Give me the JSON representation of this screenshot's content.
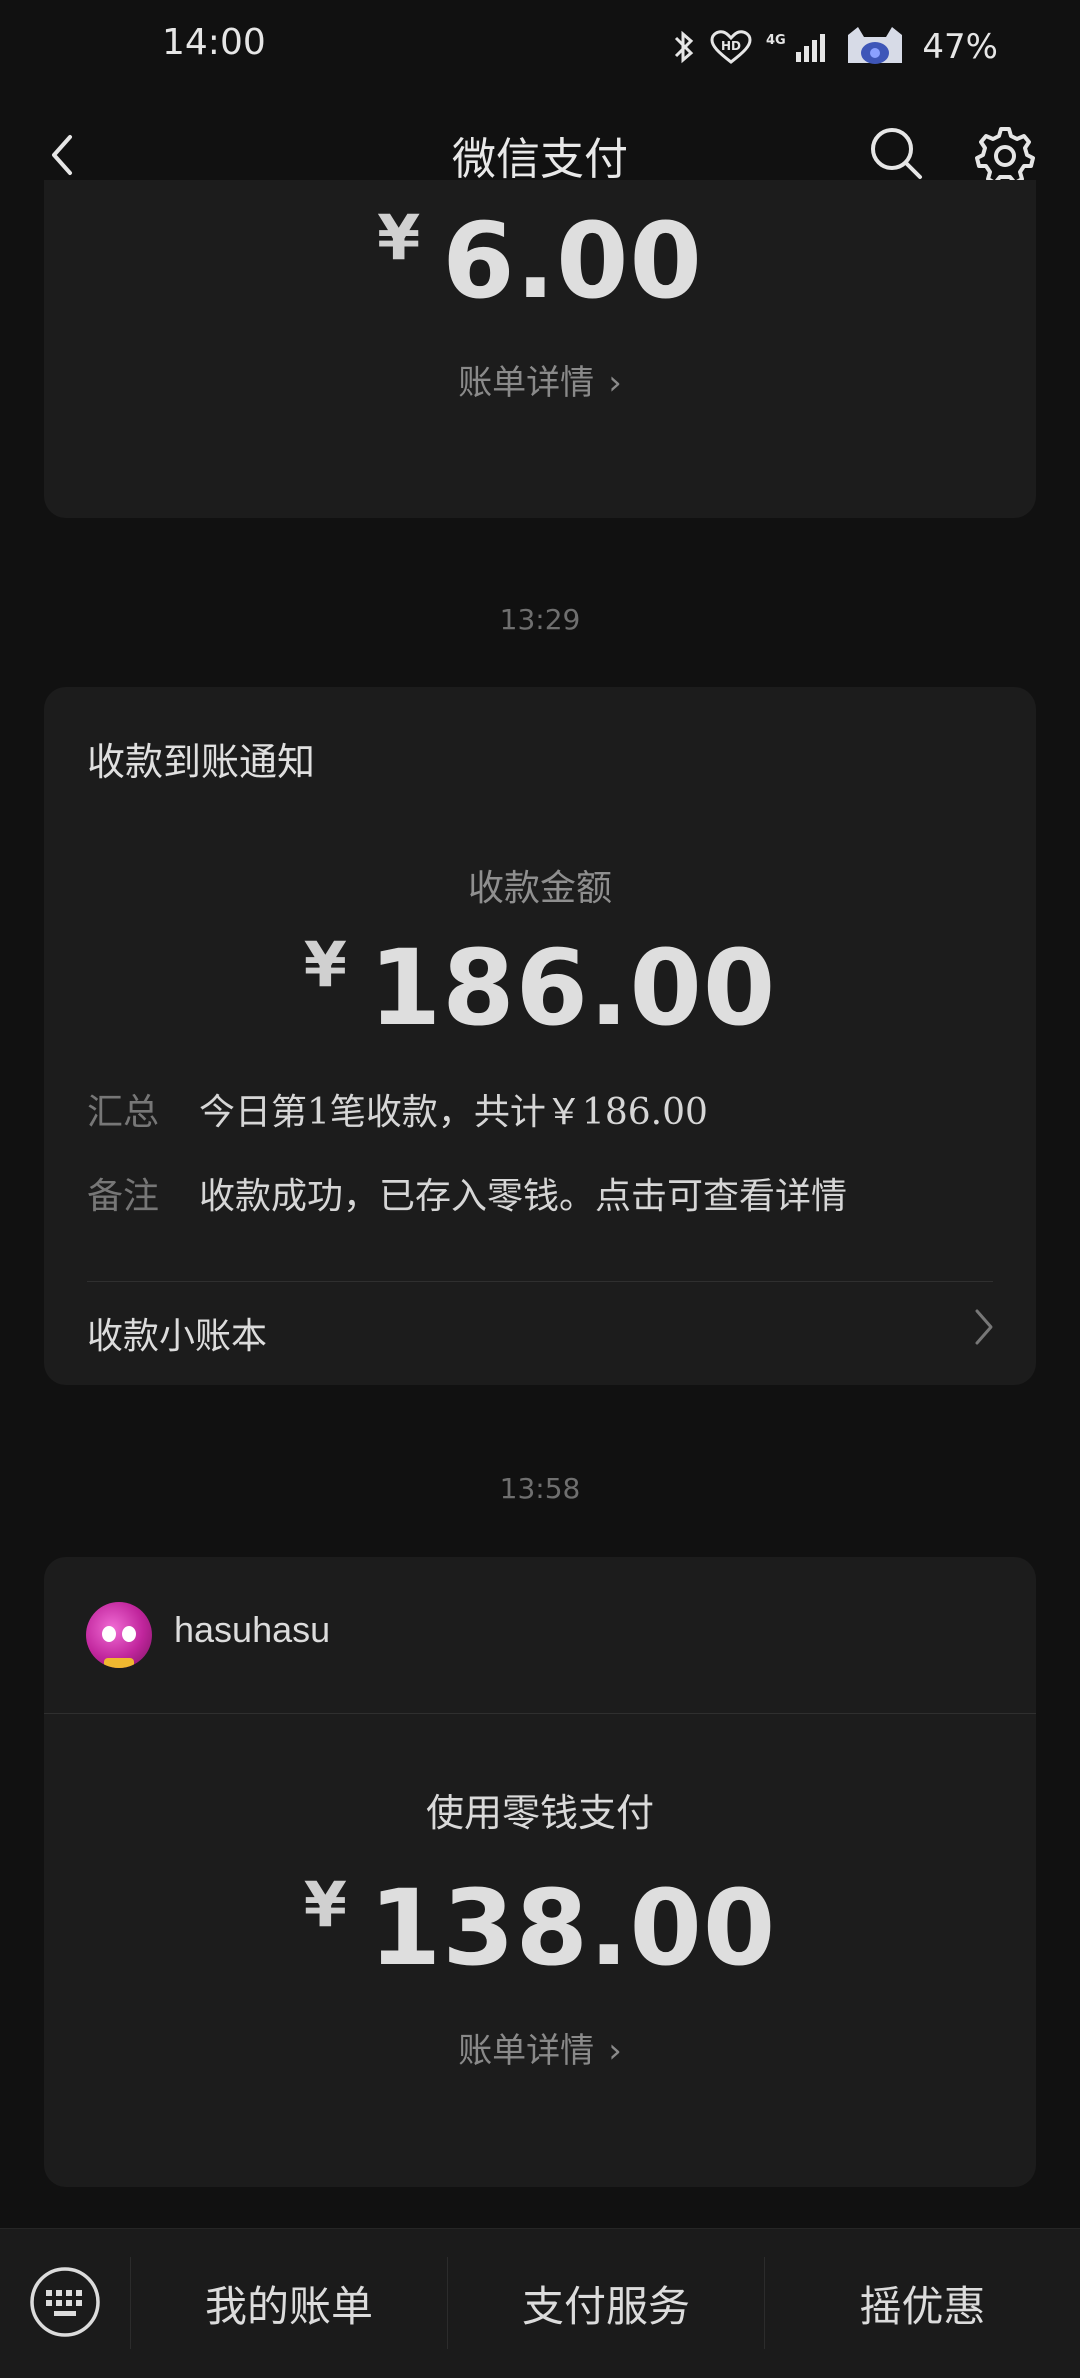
{
  "status": {
    "time": "14:00",
    "network": "4G",
    "battery": "47%",
    "icons": [
      "bluetooth-icon",
      "hd-icon",
      "signal-icon",
      "avatar-badge-icon"
    ]
  },
  "nav": {
    "title": "微信支付",
    "icons": [
      "back-icon",
      "search-icon",
      "gear-icon"
    ]
  },
  "cards": {
    "top": {
      "currency": "¥",
      "amount": "6.00",
      "detail": "账单详情",
      "chevron": "›"
    },
    "time1": "13:29",
    "notify": {
      "title": "收款到账通知",
      "label": "收款金额",
      "currency": "¥",
      "amount": "186.00",
      "summary_key": "汇总",
      "summary_val": "今日第1笔收款，共计￥186.00",
      "note_key": "备注",
      "note_val": "收款成功，已存入零钱。点击可查看详情",
      "ledger": "收款小账本"
    },
    "time2": "13:58",
    "pay": {
      "payer": "hasuhasu",
      "label": "使用零钱支付",
      "currency": "¥",
      "amount": "138.00",
      "detail": "账单详情",
      "chevron": "›"
    }
  },
  "bottom": {
    "items": [
      "我的账单",
      "支付服务",
      "摇优惠"
    ],
    "keyboard_icon": "keyboard-icon"
  },
  "colors": {
    "background": "#111111",
    "card": "#1c1c1c",
    "text": "#dedede",
    "muted": "#8a8a8a"
  }
}
